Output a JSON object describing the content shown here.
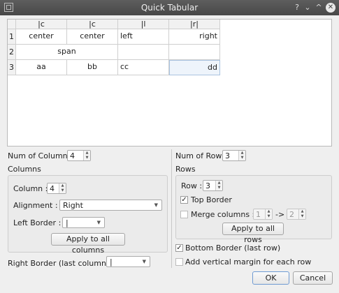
{
  "window": {
    "title": "Quick Tabular",
    "help": "?",
    "min": "⌄",
    "max": "^",
    "close": "✕"
  },
  "table": {
    "headers": [
      "|c",
      "|c",
      "|l",
      "|r|"
    ],
    "row_numbers": [
      "1",
      "2",
      "3"
    ],
    "rows": [
      [
        "center",
        "center",
        "left",
        "right"
      ],
      [
        "span",
        "",
        ""
      ],
      [
        "aa",
        "bb",
        "cc",
        "dd"
      ]
    ]
  },
  "columns": {
    "num_label": "Num of Columns",
    "num_value": "4",
    "group_label": "Columns",
    "column_label": "Column :",
    "column_value": "4",
    "alignment_label": "Alignment :",
    "alignment_value": "Right",
    "left_border_label": "Left Border :",
    "left_border_value": "|",
    "apply_label": "Apply to all columns",
    "right_border_label": "Right Border (last column) :",
    "right_border_value": "|"
  },
  "rows": {
    "num_label": "Num of Rows",
    "num_value": "3",
    "group_label": "Rows",
    "row_label": "Row :",
    "row_value": "3",
    "top_border_label": "Top Border",
    "top_border_checked": true,
    "merge_label": "Merge columns :",
    "merge_checked": false,
    "merge_from": "1",
    "merge_arrow": "->",
    "merge_to": "2",
    "apply_label": "Apply to all rows",
    "bottom_border_label": "Bottom Border (last row)",
    "bottom_border_checked": true,
    "vmargin_label": "Add vertical margin for each row",
    "vmargin_checked": false
  },
  "buttons": {
    "ok": "OK",
    "cancel": "Cancel"
  }
}
